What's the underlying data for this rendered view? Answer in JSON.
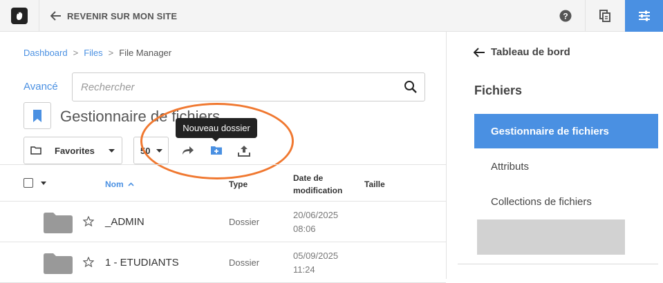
{
  "topbar": {
    "back_label": "REVENIR SUR MON SITE",
    "colors": {
      "background": "#f4f4f4",
      "active_button": "#4a90e2"
    },
    "icons": [
      "concrete5-logo-icon",
      "arrow-left-icon",
      "help-icon",
      "pages-icon",
      "sliders-icon"
    ]
  },
  "breadcrumb": {
    "items": [
      "Dashboard",
      "Files",
      "File Manager"
    ],
    "separator": ">"
  },
  "search": {
    "advanced_label": "Avancé",
    "placeholder": "Rechercher"
  },
  "page": {
    "title": "Gestionnaire de fichiers"
  },
  "toolbar": {
    "favorites_label": "Favorites",
    "per_page": "50",
    "tooltip": "Nouveau dossier",
    "icons": [
      "move-icon",
      "new-folder-icon",
      "upload-icon"
    ]
  },
  "table": {
    "headers": {
      "name": "Nom",
      "type": "Type",
      "date_line1": "Date de",
      "date_line2": "modification",
      "size": "Taille"
    },
    "rows": [
      {
        "name": "_ADMIN",
        "type": "Dossier",
        "date": "20/06/2025",
        "time": "08:06",
        "size": ""
      },
      {
        "name": "1 - ETUDIANTS",
        "type": "Dossier",
        "date": "05/09/2025",
        "time": "11:24",
        "size": ""
      }
    ]
  },
  "sidebar": {
    "back_label": "Tableau de bord",
    "heading": "Fichiers",
    "items": [
      {
        "label": "Gestionnaire de fichiers",
        "active": true
      },
      {
        "label": "Attributs",
        "active": false
      },
      {
        "label": "Collections de fichiers",
        "active": false
      }
    ]
  },
  "colors": {
    "accent": "#4a90e2",
    "highlight_ring": "#f07830",
    "tooltip_bg": "#222222"
  }
}
